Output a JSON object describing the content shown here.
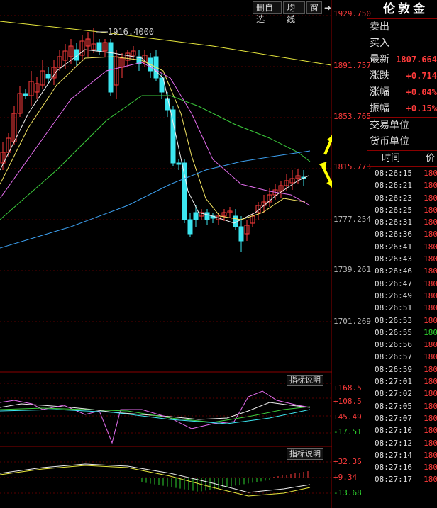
{
  "toolbar": {
    "delete_self": "删自选",
    "ma_label": "均线",
    "window_label": "窗",
    "arrow_icon": "exit-arrow-icon"
  },
  "chart": {
    "high_marker": "1916.4000",
    "price_axis": [
      "1929.750",
      "1891.757",
      "1853.765",
      "1815.773",
      "1777.254",
      "1739.261",
      "1701.269"
    ],
    "ind1_axis": [
      "+168.5",
      "+108.5",
      "+45.49",
      "-17.51"
    ],
    "ind2_axis": [
      "+32.36",
      "+9.34",
      "-13.68"
    ],
    "help_label": "指标说明",
    "colors": {
      "up": "#ff3b3b",
      "down": "#3ce6f0",
      "ma5": "#f0f0f0",
      "ma10": "#f5e663",
      "ma20": "#e66ef0",
      "ma40": "#3ccc3c",
      "ma60": "#3ca0f0",
      "trend": "#e6e63c",
      "annot": "#ffff00"
    }
  },
  "side": {
    "title": "伦敦金",
    "rows": [
      {
        "label": "卖出",
        "value": ""
      },
      {
        "label": "买入",
        "value": ""
      },
      {
        "label": "最新",
        "value": "1807.664"
      },
      {
        "label": "涨跌",
        "value": "+0.714"
      },
      {
        "label": "涨幅",
        "value": "+0.04%"
      },
      {
        "label": "振幅",
        "value": "+0.15%"
      }
    ],
    "rows2": [
      {
        "label": "交易单位",
        "value": ""
      },
      {
        "label": "货币单位",
        "value": ""
      }
    ],
    "tick_header": {
      "time": "时间",
      "price": "价"
    },
    "ticks": [
      {
        "time": "08:26:15",
        "price": "180",
        "color": "red"
      },
      {
        "time": "08:26:21",
        "price": "180",
        "color": "red"
      },
      {
        "time": "08:26:23",
        "price": "180",
        "color": "red"
      },
      {
        "time": "08:26:25",
        "price": "180",
        "color": "red"
      },
      {
        "time": "08:26:31",
        "price": "180",
        "color": "red"
      },
      {
        "time": "08:26:36",
        "price": "180",
        "color": "red"
      },
      {
        "time": "08:26:41",
        "price": "180",
        "color": "red"
      },
      {
        "time": "08:26:43",
        "price": "180",
        "color": "red"
      },
      {
        "time": "08:26:46",
        "price": "180",
        "color": "red"
      },
      {
        "time": "08:26:47",
        "price": "180",
        "color": "red"
      },
      {
        "time": "08:26:49",
        "price": "180",
        "color": "red"
      },
      {
        "time": "08:26:51",
        "price": "180",
        "color": "red"
      },
      {
        "time": "08:26:53",
        "price": "180",
        "color": "red"
      },
      {
        "time": "08:26:55",
        "price": "180",
        "color": "green"
      },
      {
        "time": "08:26:56",
        "price": "180",
        "color": "red"
      },
      {
        "time": "08:26:57",
        "price": "180",
        "color": "red"
      },
      {
        "time": "08:26:59",
        "price": "180",
        "color": "red"
      },
      {
        "time": "08:27:01",
        "price": "180",
        "color": "red"
      },
      {
        "time": "08:27:02",
        "price": "180",
        "color": "red"
      },
      {
        "time": "08:27:05",
        "price": "180",
        "color": "red"
      },
      {
        "time": "08:27:07",
        "price": "180",
        "color": "red"
      },
      {
        "time": "08:27:10",
        "price": "180",
        "color": "red"
      },
      {
        "time": "08:27:12",
        "price": "180",
        "color": "red"
      },
      {
        "time": "08:27:14",
        "price": "180",
        "color": "red"
      },
      {
        "time": "08:27:16",
        "price": "180",
        "color": "red"
      },
      {
        "time": "08:27:17",
        "price": "180",
        "color": "red"
      }
    ]
  }
}
